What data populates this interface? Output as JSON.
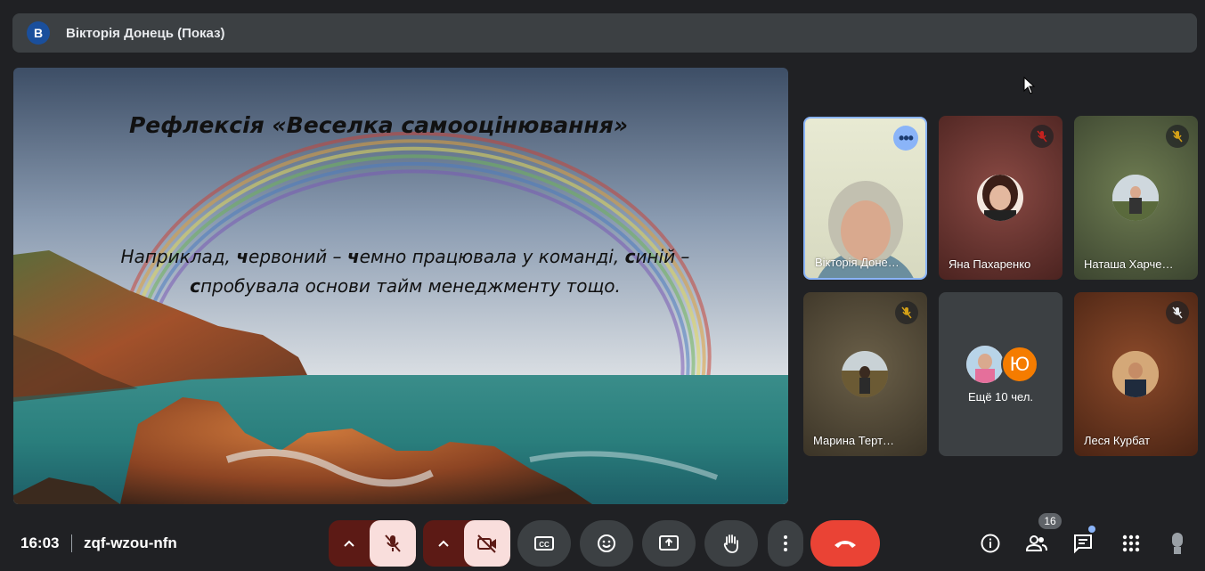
{
  "header": {
    "avatar_letter": "В",
    "presenter_label": "Вікторія Донець (Показ)"
  },
  "slide": {
    "title": "Рефлексія «Веселка самооцінювання»",
    "body_line1": [
      {
        "t": "Наприклад, ",
        "b": false
      },
      {
        "t": "ч",
        "b": true
      },
      {
        "t": "ервоний – ",
        "b": false
      },
      {
        "t": "ч",
        "b": true
      },
      {
        "t": "емно працювала у команді, ",
        "b": false
      },
      {
        "t": "с",
        "b": true
      },
      {
        "t": "иній –",
        "b": false
      }
    ],
    "body_line2": [
      {
        "t": "с",
        "b": true
      },
      {
        "t": "пробувала основи тайм менеджменту тощо.",
        "b": false
      }
    ]
  },
  "participants": [
    {
      "name": "Вікторія Доне…",
      "muted": false,
      "active": true
    },
    {
      "name": "Яна Пахаренко",
      "muted": true,
      "mute_color": "#c5221f"
    },
    {
      "name": "Наташа Харче…",
      "muted": true,
      "mute_color": "#d4a017"
    },
    {
      "name": "Марина Терт…",
      "muted": true,
      "mute_color": "#d4a017"
    },
    {
      "name": "Ещё 10 чел.",
      "extra_avatar_letter": "Ю"
    },
    {
      "name": "Леся Курбат",
      "muted": true,
      "mute_color": "#e8eaed"
    }
  ],
  "bottom": {
    "time": "16:03",
    "meeting_code": "zqf-wzou-nfn",
    "participants_count": "16",
    "icons": [
      "mic-off-icon",
      "camera-off-icon",
      "captions-icon",
      "emoji-icon",
      "present-icon",
      "raise-hand-icon",
      "more-icon",
      "end-call-icon",
      "info-icon",
      "people-icon",
      "chat-icon",
      "apps-icon",
      "lock-icon"
    ]
  },
  "colors": {
    "background": "#202124",
    "surface": "#3c4043",
    "end_call": "#ea4335",
    "accent": "#8ab4f8",
    "mic_off_bg": "#f9dedc"
  }
}
